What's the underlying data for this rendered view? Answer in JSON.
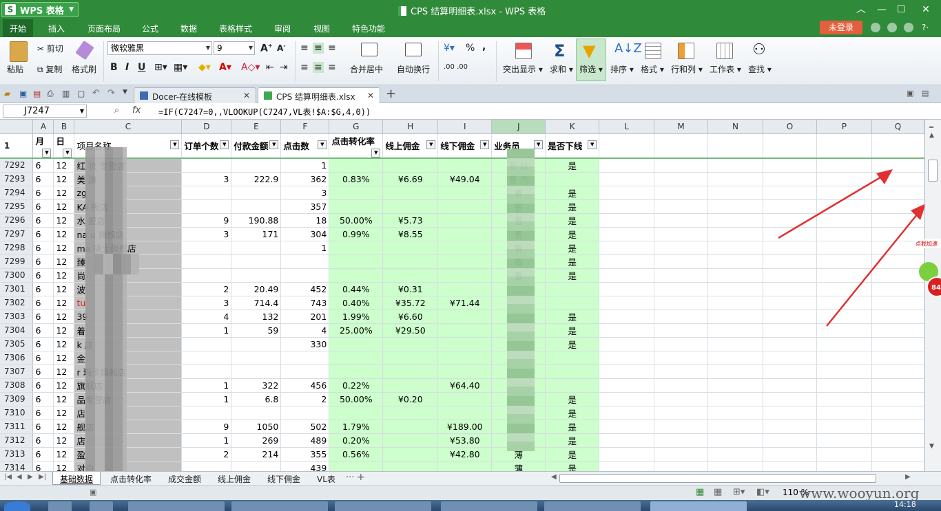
{
  "app": {
    "name": "WPS 表格",
    "window_title": "CPS 结算明细表.xlsx - WPS 表格"
  },
  "menu": {
    "items": [
      "开始",
      "插入",
      "页面布局",
      "公式",
      "数据",
      "表格样式",
      "审阅",
      "视图",
      "特色功能"
    ],
    "login": "未登录"
  },
  "ribbon": {
    "paste": "粘贴",
    "cut": "剪切",
    "copy": "复制",
    "format_painter": "格式刷",
    "font_name": "微软雅黑",
    "font_size": "9",
    "bold": "B",
    "italic": "I",
    "underline": "U",
    "merge_center": "合并居中",
    "wrap": "自动换行",
    "percent": "%",
    "comma": ",",
    "highlight": "突出显示",
    "sum": "求和",
    "filter": "筛选",
    "sort": "排序",
    "format": "格式",
    "rows_cols": "行和列",
    "worksheet": "工作表",
    "find": "查找"
  },
  "tabs": [
    {
      "label": "Docer-在线模板"
    },
    {
      "label": "CPS 结算明细表.xlsx"
    }
  ],
  "formula_bar": {
    "cell_ref": "J7247",
    "fx": "fx",
    "formula": "=IF(C7247=0,,VLOOKUP(C7247,VL表!$A:$G,4,0))"
  },
  "grid": {
    "columns": [
      "A",
      "B",
      "C",
      "D",
      "E",
      "F",
      "G",
      "H",
      "I",
      "J",
      "K",
      "L",
      "M",
      "N",
      "O",
      "P",
      "Q"
    ],
    "header_row_num": "1",
    "headers": [
      "月",
      "日",
      "项目名称",
      "订单个数",
      "付款金额",
      "点击数",
      "点击转化率",
      "线上佣金",
      "线下佣金",
      "业务员",
      "是否下线"
    ],
    "rows": [
      {
        "n": "7292",
        "a": "6",
        "b": "12",
        "c": "红    妆    专营店",
        "d": "",
        "e": "",
        "f": "1",
        "g": "",
        "h": "",
        "i": "",
        "j": "张    杭",
        "k": "是"
      },
      {
        "n": "7293",
        "a": "6",
        "b": "12",
        "c": "美    旗",
        "d": "3",
        "e": "222.9",
        "f": "362",
        "g": "0.83%",
        "h": "¥6.69",
        "i": "¥49.04",
        "j": "曹    杰",
        "k": ""
      },
      {
        "n": "7294",
        "a": "6",
        "b": "12",
        "c": "zg",
        "d": "",
        "e": "",
        "f": "3",
        "g": "",
        "h": "",
        "i": "",
        "j": "曹",
        "k": "是"
      },
      {
        "n": "7295",
        "a": "6",
        "b": "12",
        "c": "KA         舰店",
        "d": "",
        "e": "",
        "f": "357",
        "g": "",
        "h": "",
        "i": "",
        "j": "曹",
        "k": "是"
      },
      {
        "n": "7296",
        "a": "6",
        "b": "12",
        "c": "水          舰店",
        "d": "9",
        "e": "190.88",
        "f": "18",
        "g": "50.00%",
        "h": "¥5.73",
        "i": "",
        "j": "曹",
        "k": "是"
      },
      {
        "n": "7297",
        "a": "6",
        "b": "12",
        "c": "na          u   旗舰店",
        "d": "3",
        "e": "171",
        "f": "304",
        "g": "0.99%",
        "h": "¥8.55",
        "i": "",
        "j": "曹",
        "k": "是"
      },
      {
        "n": "7298",
        "a": "6",
        "b": "12",
        "c": "ma             骑士旗舰店",
        "d": "",
        "e": "",
        "f": "1",
        "g": "",
        "h": "",
        "i": "",
        "j": "曹",
        "k": "是"
      },
      {
        "n": "7299",
        "a": "6",
        "b": "12",
        "c": "臻",
        "d": "",
        "e": "",
        "f": "",
        "g": "",
        "h": "",
        "i": "",
        "j": "曹",
        "k": "是"
      },
      {
        "n": "7300",
        "a": "6",
        "b": "12",
        "c": "尚",
        "d": "",
        "e": "",
        "f": "",
        "g": "",
        "h": "",
        "i": "",
        "j": "曹",
        "k": "是"
      },
      {
        "n": "7301",
        "a": "6",
        "b": "12",
        "c": "波",
        "d": "2",
        "e": "20.49",
        "f": "452",
        "g": "0.44%",
        "h": "¥0.31",
        "i": "",
        "j": "",
        "k": ""
      },
      {
        "n": "7302",
        "a": "6",
        "b": "12",
        "c": "tu",
        "d": "3",
        "e": "714.4",
        "f": "743",
        "g": "0.40%",
        "h": "¥35.72",
        "i": "¥71.44",
        "j": "",
        "k": ""
      },
      {
        "n": "7303",
        "a": "6",
        "b": "12",
        "c": "39",
        "d": "4",
        "e": "132",
        "f": "201",
        "g": "1.99%",
        "h": "¥6.60",
        "i": "",
        "j": "",
        "k": "是"
      },
      {
        "n": "7304",
        "a": "6",
        "b": "12",
        "c": "着",
        "d": "1",
        "e": "59",
        "f": "4",
        "g": "25.00%",
        "h": "¥29.50",
        "i": "",
        "j": "",
        "k": "是"
      },
      {
        "n": "7305",
        "a": "6",
        "b": "12",
        "c": "k               店",
        "d": "",
        "e": "",
        "f": "330",
        "g": "",
        "h": "",
        "i": "",
        "j": "",
        "k": "是"
      },
      {
        "n": "7306",
        "a": "6",
        "b": "12",
        "c": "金",
        "d": "",
        "e": "",
        "f": "",
        "g": "",
        "h": "",
        "i": "",
        "j": "",
        "k": ""
      },
      {
        "n": "7307",
        "a": "6",
        "b": "12",
        "c": "r               玛卡旗舰店",
        "d": "",
        "e": "",
        "f": "",
        "g": "",
        "h": "",
        "i": "",
        "j": "",
        "k": ""
      },
      {
        "n": "7308",
        "a": "6",
        "b": "12",
        "c": "           旗舰店",
        "d": "1",
        "e": "322",
        "f": "456",
        "g": "0.22%",
        "h": "",
        "i": "¥64.40",
        "j": "",
        "k": ""
      },
      {
        "n": "7309",
        "a": "6",
        "b": "12",
        "c": "           品专营店",
        "d": "1",
        "e": "6.8",
        "f": "2",
        "g": "50.00%",
        "h": "¥0.20",
        "i": "",
        "j": "",
        "k": "是"
      },
      {
        "n": "7310",
        "a": "6",
        "b": "12",
        "c": "           店",
        "d": "",
        "e": "",
        "f": "",
        "g": "",
        "h": "",
        "i": "",
        "j": "",
        "k": "是"
      },
      {
        "n": "7311",
        "a": "6",
        "b": "12",
        "c": "           舰店",
        "d": "9",
        "e": "1050",
        "f": "502",
        "g": "1.79%",
        "h": "",
        "i": "¥189.00",
        "j": "",
        "k": "是"
      },
      {
        "n": "7312",
        "a": "6",
        "b": "12",
        "c": "           店",
        "d": "1",
        "e": "269",
        "f": "489",
        "g": "0.20%",
        "h": "",
        "i": "¥53.80",
        "j": "",
        "k": "是"
      },
      {
        "n": "7313",
        "a": "6",
        "b": "12",
        "c": "盈",
        "d": "2",
        "e": "214",
        "f": "355",
        "g": "0.56%",
        "h": "",
        "i": "¥42.80",
        "j": "薄",
        "k": "是"
      },
      {
        "n": "7314",
        "a": "6",
        "b": "12",
        "c": "对白",
        "d": "",
        "e": "",
        "f": "439",
        "g": "",
        "h": "",
        "i": "",
        "j": "薄",
        "k": "是"
      },
      {
        "n": "7315",
        "a": "6",
        "b": "12",
        "c": "衣品天         旗舰店",
        "d": "2",
        "e": "108",
        "f": "630",
        "g": "0.32%",
        "h": "",
        "i": "¥21.60",
        "j": "薄",
        "k": "是"
      }
    ]
  },
  "sheets": [
    "基础数据",
    "点击转化率",
    "成交金额",
    "线上佣金",
    "线下佣金",
    "VL表"
  ],
  "status": {
    "zoom": "110 %"
  },
  "watermark": "www.wooyun.org",
  "badge": {
    "text": "点我加速",
    "number": "84"
  },
  "clock": "14:18",
  "colors": {
    "title_green": "#2f8a3a",
    "cell_green": "#ccffcc",
    "cell_gray": "#c0c0c0",
    "red_text": "#e02020"
  }
}
